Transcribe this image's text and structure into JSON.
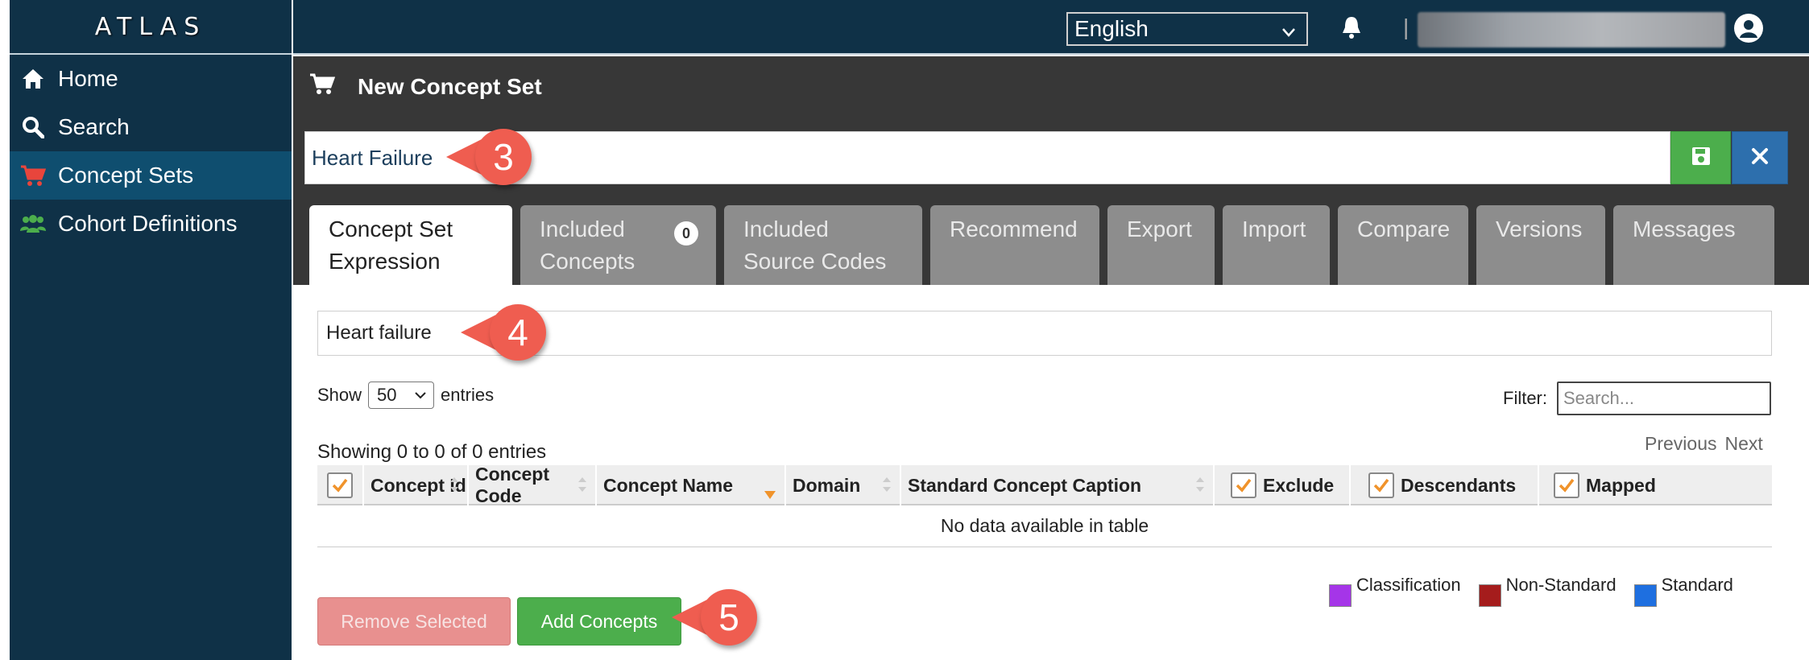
{
  "app": {
    "title": "ATLAS"
  },
  "sidebar": {
    "items": [
      {
        "label": "Home",
        "icon": "home-icon"
      },
      {
        "label": "Search",
        "icon": "search-icon"
      },
      {
        "label": "Concept Sets",
        "icon": "cart-icon",
        "active": true
      },
      {
        "label": "Cohort Definitions",
        "icon": "users-icon"
      }
    ]
  },
  "topbar": {
    "language": "English",
    "separator": "|"
  },
  "page": {
    "title": "New Concept Set",
    "concept_set_name": "Heart Failure"
  },
  "tabs": [
    {
      "line1": "Concept Set",
      "line2": "Expression",
      "active": true
    },
    {
      "line1": "Included",
      "line2": "Concepts",
      "badge": "0"
    },
    {
      "line1": "Included",
      "line2": "Source Codes"
    },
    {
      "line1": "Recommend"
    },
    {
      "line1": "Export"
    },
    {
      "line1": "Import"
    },
    {
      "line1": "Compare"
    },
    {
      "line1": "Versions"
    },
    {
      "line1": "Messages"
    }
  ],
  "callouts": {
    "step3": "3",
    "step4": "4",
    "step5": "5"
  },
  "expression": {
    "search_text": "Heart failure"
  },
  "table_controls": {
    "show_label": "Show",
    "show_value": "50",
    "entries_label": "entries",
    "filter_label": "Filter:",
    "filter_placeholder": "Search...",
    "info": "Showing 0 to 0 of 0 entries",
    "previous": "Previous",
    "next": "Next"
  },
  "table": {
    "columns": [
      "Concept Id",
      "Concept Code",
      "Concept Name",
      "Domain",
      "Standard Concept Caption",
      "Exclude",
      "Descendants",
      "Mapped"
    ],
    "empty_message": "No data available in table"
  },
  "legend": [
    {
      "label": "Classification",
      "color": "#a535e8"
    },
    {
      "label": "Non-Standard",
      "color": "#a51c1c"
    },
    {
      "label": "Standard",
      "color": "#1e6fe0"
    }
  ],
  "buttons": {
    "remove_selected": "Remove Selected",
    "add_concepts": "Add Concepts"
  },
  "colors": {
    "sidebar_bg": "#0f3147",
    "accent_orange": "#f0932b",
    "callout": "#ef5d50",
    "success": "#4cae4c",
    "primary": "#2d6fad",
    "danger_disabled": "#e8908f"
  }
}
